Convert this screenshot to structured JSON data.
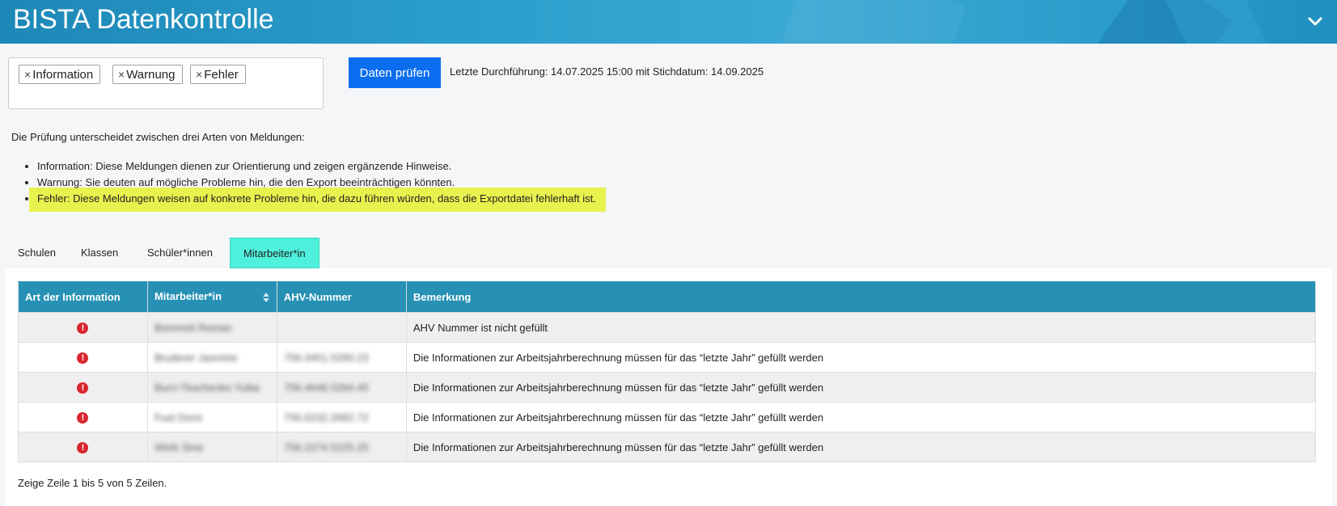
{
  "app": {
    "title": "BISTA Datenkontrolle"
  },
  "filters": {
    "tags": [
      {
        "label": "Information"
      },
      {
        "label": "Warnung"
      },
      {
        "label": "Fehler"
      }
    ]
  },
  "actions": {
    "check_label": "Daten prüfen",
    "last_run": "Letzte Durchführung: 14.07.2025 15:00 mit Stichdatum: 14.09.2025"
  },
  "intro": {
    "text": "Die Prüfung unterscheidet zwischen drei Arten von Meldungen:",
    "items": [
      "Information: Diese Meldungen dienen zur Orientierung und zeigen ergänzende Hinweise.",
      "Warnung: Sie deuten auf mögliche Probleme hin, die den Export beeinträchtigen könnten.",
      "Fehler: Diese Meldungen weisen auf konkrete Probleme hin, die dazu führen würden, dass die Exportdatei fehlerhaft ist."
    ]
  },
  "tabs": [
    {
      "label": "Schulen"
    },
    {
      "label": "Klassen"
    },
    {
      "label": "Schüler*innen"
    },
    {
      "label": "Mitarbeiter*in"
    }
  ],
  "table": {
    "columns": [
      "Art der Information",
      "Mitarbeiter*in",
      "AHV-Nummer",
      "Bemerkung"
    ],
    "rows": [
      {
        "type_icon": "error-icon",
        "name": "Bommeli Roman",
        "ahv": "",
        "remark": "AHV Nummer ist nicht gefüllt"
      },
      {
        "type_icon": "error-icon",
        "name": "Bruderer Jasmine",
        "ahv": "756.3451.5290.23",
        "remark": "Die Informationen zur Arbeitsjahrberechnung müssen für das “letzte Jahr” gefüllt werden"
      },
      {
        "type_icon": "error-icon",
        "name": "Burri-Tkachenko Yuliia",
        "ahv": "756.4646.5264.45",
        "remark": "Die Informationen zur Arbeitsjahrberechnung müssen für das “letzte Jahr” gefüllt werden"
      },
      {
        "type_icon": "error-icon",
        "name": "Fust Doris",
        "ahv": "756.6232.2682.72",
        "remark": "Die Informationen zur Arbeitsjahrberechnung müssen für das “letzte Jahr” gefüllt werden"
      },
      {
        "type_icon": "error-icon",
        "name": "Wirth Sina",
        "ahv": "756.2274.5225.25",
        "remark": "Die Informationen zur Arbeitsjahrberechnung müssen für das “letzte Jahr” gefüllt werden"
      }
    ],
    "footer": "Zeige Zeile 1 bis 5 von 5 Zeilen."
  },
  "colors": {
    "header": "#2a9fcb",
    "primary_button": "#0b6ef0",
    "active_tab": "#4ff0dc",
    "highlight": "#e8f24e",
    "table_header": "#2691b4",
    "error": "#d9262f"
  },
  "icons": {
    "header_toggle": "chevron-down-icon",
    "tag_remove": "close-icon",
    "row_type": "error-icon",
    "sort": "sort-icon"
  }
}
